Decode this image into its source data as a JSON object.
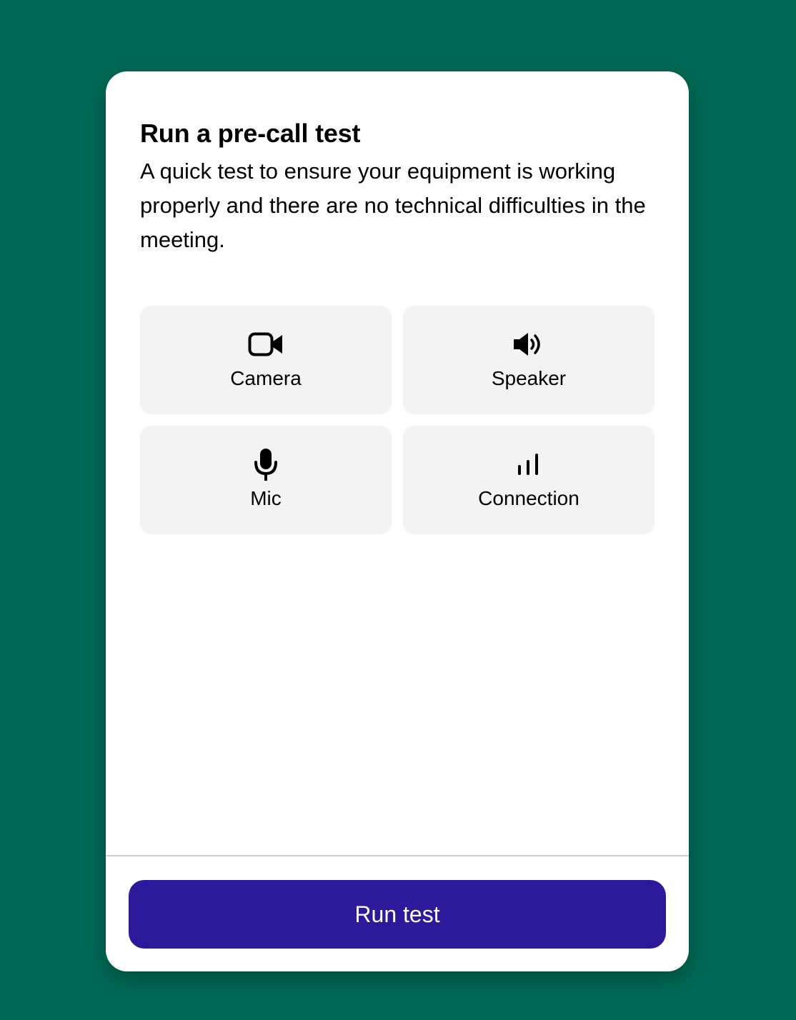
{
  "card": {
    "title": "Run a pre-call test",
    "description": "A quick test to ensure your equipment is working properly and there are no technical difficulties in the meeting."
  },
  "tests": [
    {
      "label": "Camera",
      "icon": "camera-icon"
    },
    {
      "label": "Speaker",
      "icon": "speaker-icon"
    },
    {
      "label": "Mic",
      "icon": "microphone-icon"
    },
    {
      "label": "Connection",
      "icon": "signal-bars-icon"
    }
  ],
  "footer": {
    "run_label": "Run test"
  },
  "colors": {
    "background": "#006853",
    "card": "#ffffff",
    "tile": "#f3f3f3",
    "primary_button": "#2c1a9b"
  }
}
